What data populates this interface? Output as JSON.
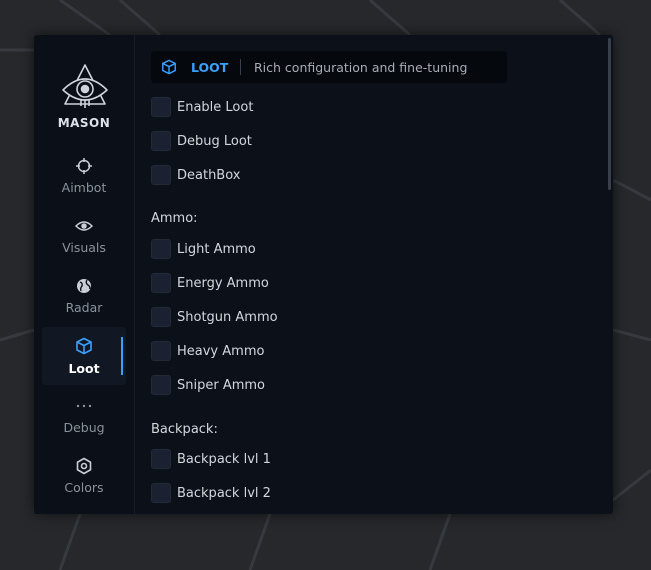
{
  "brand": {
    "name": "MASON",
    "logo_icon": "eye-triangle-icon"
  },
  "sidebar": {
    "items": [
      {
        "label": "Aimbot",
        "icon": "crosshair-icon",
        "active": false
      },
      {
        "label": "Visuals",
        "icon": "eye-icon",
        "active": false
      },
      {
        "label": "Radar",
        "icon": "globe-icon",
        "active": false
      },
      {
        "label": "Loot",
        "icon": "cube-icon",
        "active": true
      },
      {
        "label": "Debug",
        "icon": "ellipsis-icon",
        "active": false
      },
      {
        "label": "Colors",
        "icon": "cog-icon",
        "active": false
      }
    ]
  },
  "header": {
    "icon": "cube-icon",
    "title": "LOOT",
    "subtitle": "Rich configuration and fine-tuning"
  },
  "loot_options": [
    {
      "label": "Enable Loot",
      "checked": false
    },
    {
      "label": "Debug Loot",
      "checked": false
    },
    {
      "label": "DeathBox",
      "checked": false
    }
  ],
  "ammo": {
    "title": "Ammo:",
    "options": [
      {
        "label": "Light Ammo",
        "checked": false
      },
      {
        "label": "Energy Ammo",
        "checked": false
      },
      {
        "label": "Shotgun Ammo",
        "checked": false
      },
      {
        "label": "Heavy Ammo",
        "checked": false
      },
      {
        "label": "Sniper Ammo",
        "checked": false
      }
    ]
  },
  "backpack": {
    "title": "Backpack:",
    "options": [
      {
        "label": "Backpack lvl 1",
        "checked": false
      },
      {
        "label": "Backpack lvl 2",
        "checked": false
      }
    ]
  },
  "colors": {
    "accent": "#3aa0ff",
    "panel": "#0c1119",
    "checkbox": "#1b2130"
  }
}
